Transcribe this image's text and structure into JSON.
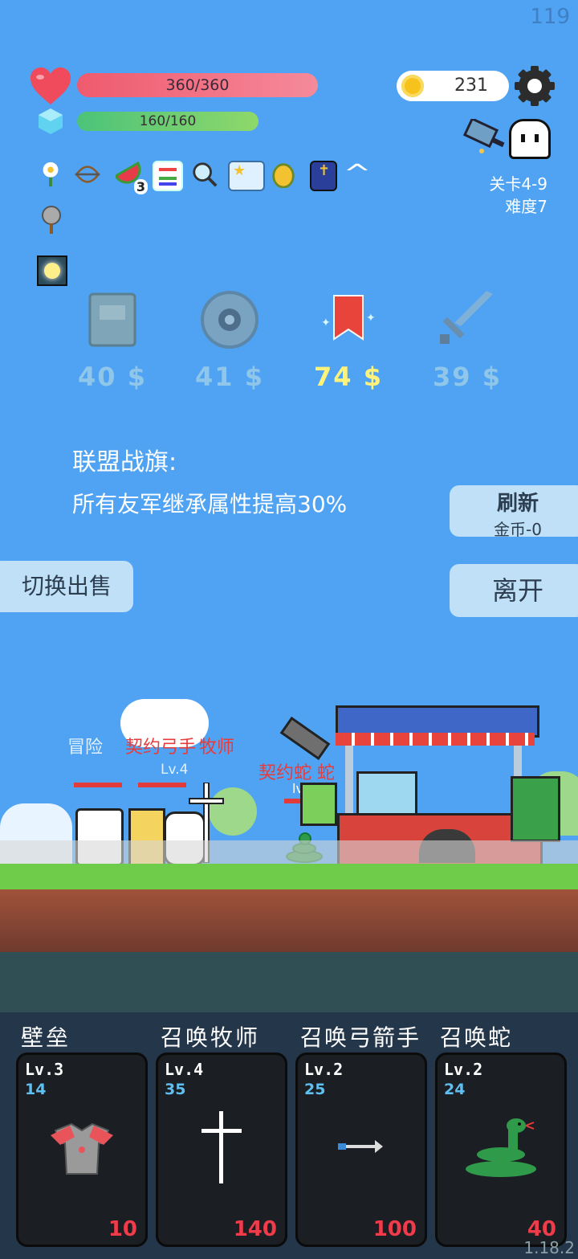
{
  "fps": "119",
  "version": "1.18.2",
  "player": {
    "hp_text": "360/360",
    "mp_text": "160/160",
    "hp_fraction": 1.0,
    "mp_fraction": 1.0
  },
  "coins": "231",
  "stage": {
    "level": "关卡4-9",
    "difficulty": "难度7"
  },
  "items": [
    {
      "icon": "flower-icon",
      "badge": ""
    },
    {
      "icon": "crossbow-icon",
      "badge": ""
    },
    {
      "icon": "watermelon-icon",
      "badge": "3"
    },
    {
      "icon": "list-icon",
      "badge": ""
    },
    {
      "icon": "magnifier-icon",
      "badge": ""
    },
    {
      "icon": "star-card-icon",
      "badge": ""
    },
    {
      "icon": "pineapple-icon",
      "badge": ""
    },
    {
      "icon": "holy-book-icon",
      "badge": ""
    },
    {
      "icon": "collapse-chevron-icon",
      "badge": ""
    },
    {
      "icon": "spiked-mace-icon",
      "badge": ""
    },
    {
      "icon": "glow-gem-icon",
      "badge": ""
    }
  ],
  "shop": [
    {
      "icon": "book-icon",
      "price": "40 $",
      "selected": false
    },
    {
      "icon": "shield-icon",
      "price": "41 $",
      "selected": false
    },
    {
      "icon": "banner-icon",
      "price": "74 $",
      "selected": true
    },
    {
      "icon": "sword-icon",
      "price": "39 $",
      "selected": false
    }
  ],
  "description": {
    "title": "联盟战旗:",
    "body": "所有友军继承属性提高30%"
  },
  "buttons": {
    "refresh_label": "刷新",
    "refresh_cost": "金币-0",
    "switch_label": "切换出售",
    "leave_label": "离开"
  },
  "scene": {
    "ally_labels": [
      "冒险",
      "契约弓手",
      "牧师"
    ],
    "ally_level": "Lv.4",
    "enemy_label": "契约蛇 蛇",
    "enemy_level": "lv.2"
  },
  "cards": [
    {
      "name": "壁垒",
      "level": "Lv.3",
      "number": "14",
      "cost": "10",
      "icon": "armor-icon"
    },
    {
      "name": "召唤牧师",
      "level": "Lv.4",
      "number": "35",
      "cost": "140",
      "icon": "cross-icon"
    },
    {
      "name": "召唤弓箭手",
      "level": "Lv.2",
      "number": "25",
      "cost": "100",
      "icon": "arrow-icon"
    },
    {
      "name": "召唤蛇",
      "level": "Lv.2",
      "number": "24",
      "cost": "40",
      "icon": "snake-icon"
    }
  ],
  "colors": {
    "background": "#4fa3f2",
    "hp": "#ef5a6e",
    "mp": "#4bc37a",
    "price_selected": "#fff27a",
    "price_normal": "#8fc6ea",
    "card_cost": "#ef3b4a",
    "card_number": "#5ec0f2"
  }
}
